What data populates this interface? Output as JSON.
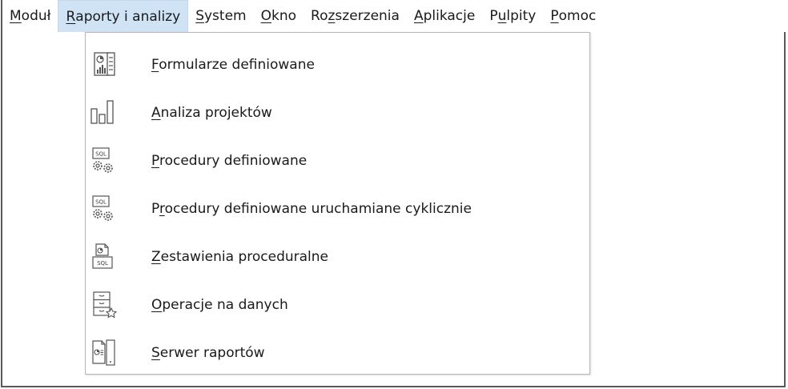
{
  "menubar": {
    "items": [
      {
        "pre": "",
        "ul": "M",
        "post": "oduł"
      },
      {
        "pre": "",
        "ul": "R",
        "post": "aporty i analizy"
      },
      {
        "pre": "",
        "ul": "S",
        "post": "ystem"
      },
      {
        "pre": "",
        "ul": "O",
        "post": "kno"
      },
      {
        "pre": "Ro",
        "ul": "z",
        "post": "szerzenia"
      },
      {
        "pre": "",
        "ul": "A",
        "post": "plikacje"
      },
      {
        "pre": "P",
        "ul": "u",
        "post": "lpity"
      },
      {
        "pre": "",
        "ul": "P",
        "post": "omoc"
      }
    ]
  },
  "dropdown": {
    "items": [
      {
        "pre": "",
        "ul": "F",
        "post": "ormularze definiowane",
        "icon": "form-chart-icon"
      },
      {
        "pre": "",
        "ul": "A",
        "post": "naliza projektów",
        "icon": "bar-chart-icon"
      },
      {
        "pre": "",
        "ul": "P",
        "post": "rocedury definiowane",
        "icon": "sql-gears-icon"
      },
      {
        "pre": "P",
        "ul": "r",
        "post": "ocedury definiowane uruchamiane cyklicznie",
        "icon": "sql-gears-icon"
      },
      {
        "pre": "",
        "ul": "Z",
        "post": "estawienia proceduralne",
        "icon": "sql-document-icon"
      },
      {
        "pre": "",
        "ul": "O",
        "post": "peracje na danych",
        "icon": "cabinet-star-icon"
      },
      {
        "pre": "",
        "ul": "S",
        "post": "erwer raportów",
        "icon": "report-server-icon"
      }
    ],
    "sql_label": "SQL"
  },
  "colors": {
    "active_menu_bg": "#cfe3f5",
    "icon_stroke": "#555555"
  }
}
